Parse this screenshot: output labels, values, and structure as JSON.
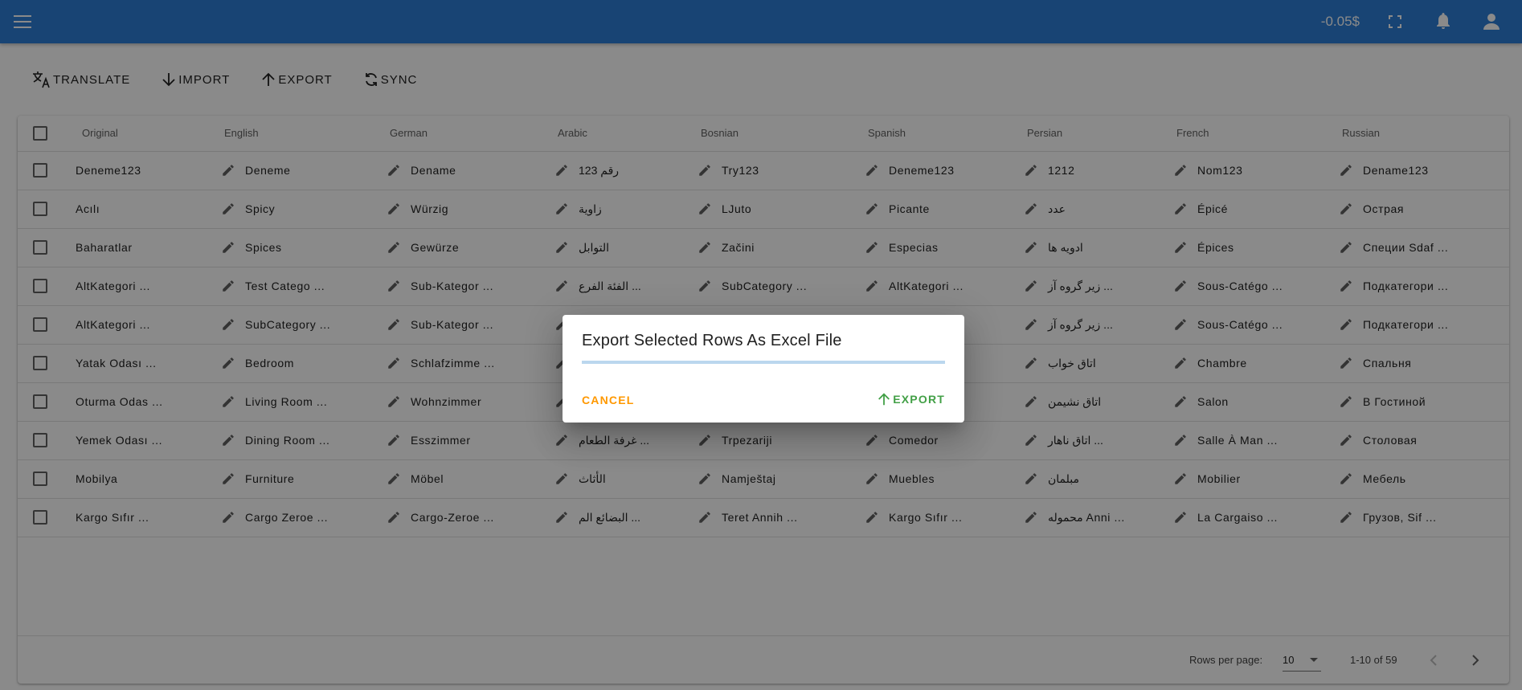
{
  "appbar": {
    "balance": "-0.05$",
    "menu_icon": "menu-icon",
    "fullscreen_icon": "fullscreen-icon",
    "bell_icon": "bell-icon",
    "account_icon": "account-icon",
    "color": "#2e7fd6"
  },
  "toolbar": {
    "translate_label": "TRANSLATE",
    "import_label": "IMPORT",
    "export_label": "EXPORT",
    "sync_label": "SYNC"
  },
  "table": {
    "headers": [
      "Original",
      "English",
      "German",
      "Arabic",
      "Bosnian",
      "Spanish",
      "Persian",
      "French",
      "Russian"
    ],
    "rows": [
      [
        "Deneme123",
        "Deneme",
        "Dename",
        "رقم 123",
        "Try123",
        "Deneme123",
        "1212",
        "Nom123",
        "Dename123"
      ],
      [
        "Acılı",
        "Spicy",
        "Würzig",
        "زاوية",
        "LJuto",
        "Picante",
        "عدد",
        "Épicé",
        "Острая"
      ],
      [
        "Baharatlar",
        "Spices",
        "Gewürze",
        "التوابل",
        "Začini",
        "Especias",
        "ادویه ها",
        "Épices",
        "Специи Sdaf ..."
      ],
      [
        "AltKategori ...",
        "Test Catego ...",
        "Sub-Kategor ...",
        "الفئة الفرع ...",
        "SubCategory ...",
        "AltKategori ...",
        "زیر گروه آز ...",
        "Sous-Catégo ...",
        "Подкатегори ..."
      ],
      [
        "AltKategori ...",
        "SubCategory ...",
        "Sub-Kategor ...",
        "",
        "",
        "",
        "زیر گروه آز ...",
        "Sous-Catégo ...",
        "Подкатегори ..."
      ],
      [
        "Yatak Odası ...",
        "Bedroom",
        "Schlafzimme ...",
        "",
        "",
        "",
        "اتاق خواب",
        "Chambre",
        "Спальня"
      ],
      [
        "Oturma Odas ...",
        "Living Room ...",
        "Wohnzimmer",
        "",
        "",
        "",
        "اتاق نشیمن",
        "Salon",
        "В Гостиной"
      ],
      [
        "Yemek Odası ...",
        "Dining Room ...",
        "Esszimmer",
        "غرفة الطعام ...",
        "Trpezariji",
        "Comedor",
        "اتاق ناهار ...",
        "Salle À Man ...",
        "Столовая"
      ],
      [
        "Mobilya",
        "Furniture",
        "Möbel",
        "الأثاث",
        "Namještaj",
        "Muebles",
        "مبلمان",
        "Mobilier",
        "Мебель"
      ],
      [
        "Kargo Sıfır ...",
        "Cargo Zeroe ...",
        "Cargo-Zeroe ...",
        "البضائع الم ...",
        "Teret Annih ...",
        "Kargo Sıfır ...",
        "محموله Anni ...",
        "La Cargaiso ...",
        "Грузов, Sif ..."
      ]
    ]
  },
  "footer": {
    "rows_per_page_label": "Rows per page:",
    "rows_per_page_value": "10",
    "range": "1-10 of 59"
  },
  "dialog": {
    "title": "Export Selected Rows As Excel File",
    "cancel_label": "CANCEL",
    "export_label": "EXPORT",
    "progress": 0.0
  }
}
